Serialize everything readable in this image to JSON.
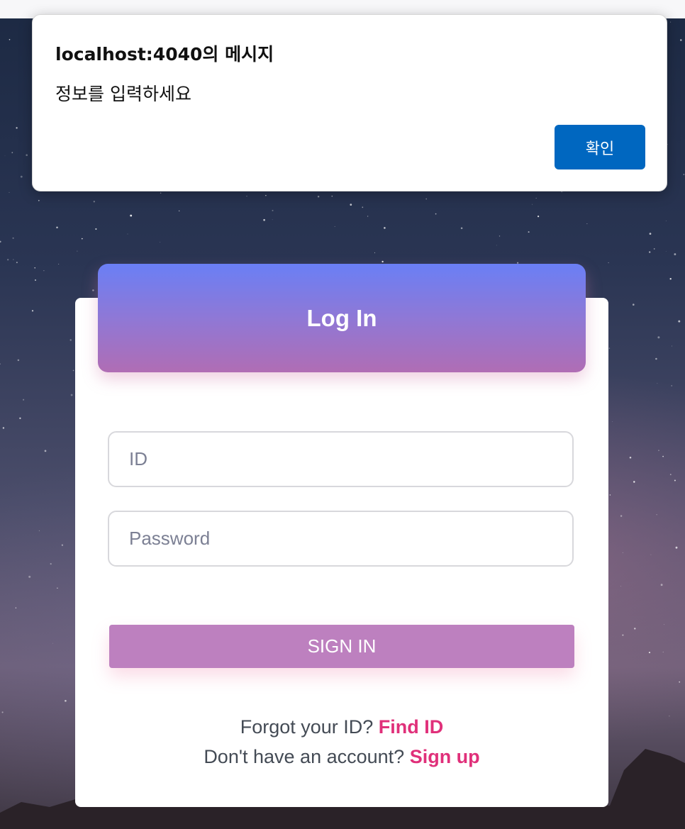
{
  "dialog": {
    "title": "localhost:4040의 메시지",
    "message": "정보를 입력하세요",
    "ok_label": "확인"
  },
  "login": {
    "title": "Log In",
    "id_placeholder": "ID",
    "password_placeholder": "Password",
    "signin_label": "SIGN IN",
    "forgot_text": "Forgot your ID?",
    "find_id_link": "Find ID",
    "no_account_text": "Don't have an account?",
    "signup_link": "Sign up"
  },
  "colors": {
    "dialog_button": "#0067c0",
    "header_gradient_top": "#6a7ff5",
    "header_gradient_bottom": "#b06db4",
    "signin_button": "#bd80bf",
    "link": "#e0307a"
  }
}
